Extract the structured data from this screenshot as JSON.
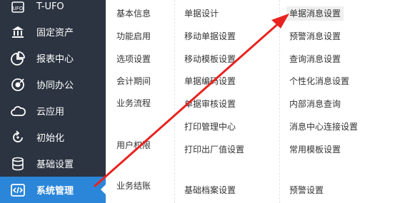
{
  "sidebar": {
    "items": [
      {
        "label": "T-UFO",
        "icon": "ufo-icon"
      },
      {
        "label": "固定资产",
        "icon": "bank-icon"
      },
      {
        "label": "报表中心",
        "icon": "pie-chart-icon"
      },
      {
        "label": "协同办公",
        "icon": "target-icon"
      },
      {
        "label": "云应用",
        "icon": "cloud-icon"
      },
      {
        "label": "初始化",
        "icon": "refresh-icon"
      },
      {
        "label": "基础设置",
        "icon": "database-icon"
      },
      {
        "label": "系统管理",
        "icon": "code-icon",
        "active": true
      }
    ]
  },
  "menu": {
    "col1": [
      "基本信息",
      "功能启用",
      "选项设置",
      "会计期间",
      "业务流程",
      "用户权限",
      "业务结账"
    ],
    "col2": [
      "单据设计",
      "移动单据设置",
      "移动模板设置",
      "单据编码设置",
      "单据审核设置",
      "打印管理中心",
      "打印出厂值设置",
      "基础档案设置"
    ],
    "col3": [
      "单据消息设置",
      "预警消息设置",
      "查询消息设置",
      "个性化消息设置",
      "内部消息查询",
      "消息中心连接设置",
      "常用模板设置",
      "预警设置"
    ]
  },
  "colors": {
    "sidebar_bg": "#2c3441",
    "active_bg": "#2b86d9",
    "arrow": "#e8231f"
  }
}
